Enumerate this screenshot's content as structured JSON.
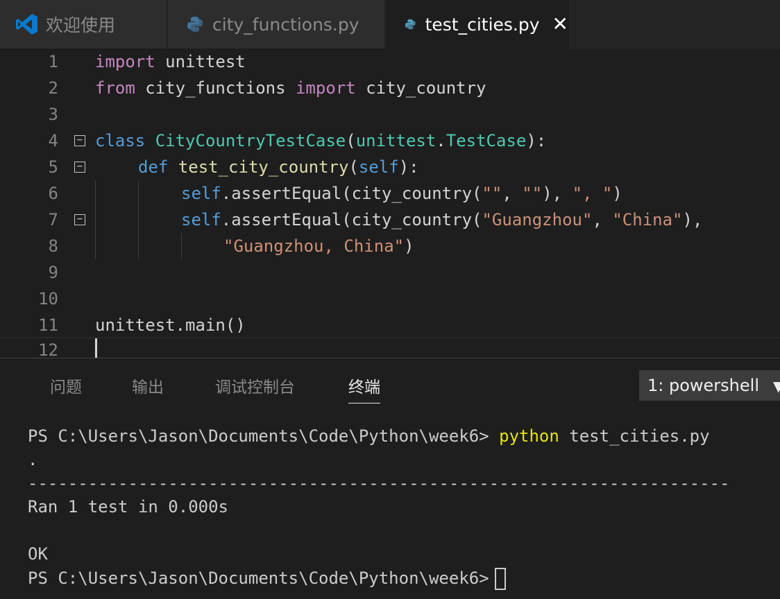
{
  "tabs": {
    "welcome": "欢迎使用",
    "func": "city_functions.py",
    "test": "test_cities.py"
  },
  "icons": {
    "vscode": "vscode-logo-icon",
    "python": "python-icon",
    "close": "close-icon",
    "fold": "fold-icon",
    "dropdown": "chevron-down-icon"
  },
  "colors": {
    "keyword": "#c586c0",
    "keyword_blue": "#569cd6",
    "class": "#4ec9b0",
    "function": "#dcdcaa",
    "string": "#ce9178",
    "accent_vscode": "#0a7acc"
  },
  "editor": {
    "line_numbers": [
      "1",
      "2",
      "3",
      "4",
      "5",
      "6",
      "7",
      "8",
      "9",
      "10",
      "11",
      "12"
    ],
    "l1": {
      "kw": "import",
      "rest": " unittest"
    },
    "l2": {
      "kw1": "from",
      "mid": " city_functions ",
      "kw2": "import",
      "rest": " city_country"
    },
    "l4": {
      "kw": "class",
      "sp": " ",
      "cls": "CityCountryTestCase",
      "p1": "(",
      "base_mod": "unittest",
      "dot": ".",
      "base_cls": "TestCase",
      "p2": "):"
    },
    "l5": {
      "kw": "def",
      "sp": " ",
      "fn": "test_city_country",
      "p1": "(",
      "self": "self",
      "p2": "):"
    },
    "l6": {
      "self": "self",
      "call": ".assertEqual(city_country(",
      "s1": "\"\"",
      "c1": ", ",
      "s2": "\"\"",
      "c2": "), ",
      "s3": "\", \"",
      "end": ")"
    },
    "l7": {
      "self": "self",
      "call": ".assertEqual(city_country(",
      "s1": "\"Guangzhou\"",
      "c1": ", ",
      "s2": "\"China\"",
      "end": "),"
    },
    "l8": {
      "s1": "\"Guangzhou, China\"",
      "end": ")"
    },
    "l11": {
      "text": "unittest.main()"
    }
  },
  "panel": {
    "tabs": [
      "问题",
      "输出",
      "调试控制台",
      "终端"
    ],
    "terminal_select": "1: powershell",
    "terminal": {
      "prompt": "PS C:\\Users\\Jason\\Documents\\Code\\Python\\week6> ",
      "cmd": "python",
      "cmd_args": " test_cities.py",
      "dot": ".",
      "rule": "----------------------------------------------------------------------",
      "ran": "Ran 1 test in 0.000s",
      "ok": "OK",
      "prompt2": "PS C:\\Users\\Jason\\Documents\\Code\\Python\\week6>"
    }
  }
}
